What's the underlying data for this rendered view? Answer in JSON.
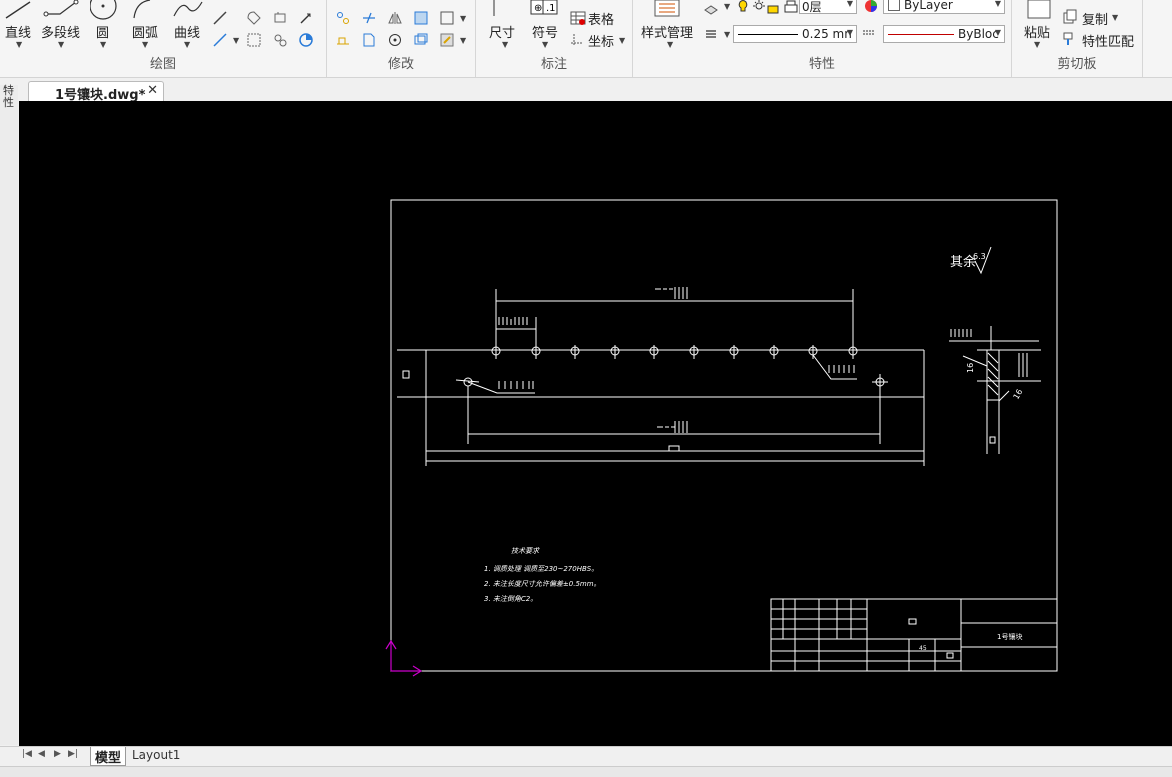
{
  "ribbon": {
    "draw": {
      "label": "绘图",
      "line": "直线",
      "polyline": "多段线",
      "circle": "圆",
      "arc": "圆弧",
      "curve": "曲线"
    },
    "modify": {
      "label": "修改"
    },
    "annotate": {
      "label": "标注",
      "dimension": "尺寸",
      "symbol": "符号",
      "table": "表格",
      "coordinate": "坐标"
    },
    "properties": {
      "label": "特性",
      "style_manager": "样式管理",
      "layer_value": "0层",
      "color_value": "ByLayer",
      "lineweight_value": "0.25 mn",
      "linetype_value": "ByBloc"
    },
    "clipboard": {
      "label": "剪切板",
      "paste": "粘贴",
      "copy": "复制",
      "match_properties": "特性匹配"
    }
  },
  "document_tab": {
    "name": "1号镶块.dwg*"
  },
  "side_strip": {
    "text": "特性"
  },
  "layout_tabs": [
    "模型",
    "Layout1"
  ],
  "drawing": {
    "roughness_label": "其余",
    "roughness_value": "6.3",
    "note_title": "技术要求",
    "notes": [
      "1. 调质处理 调质至230~270HBS。",
      "2. 未注长度尺寸允许偏差±0.5mm。",
      "3. 未注倒角C2。"
    ],
    "title_part_name": "1号镶块",
    "title_material": "45",
    "section_mark_left": "16",
    "section_mark_right": "16"
  },
  "colors": {
    "canvas": "#000000",
    "drawing_lines": "#ffffff",
    "ucs_icon": "#cc00cc",
    "linetype_red": "#c00000"
  }
}
